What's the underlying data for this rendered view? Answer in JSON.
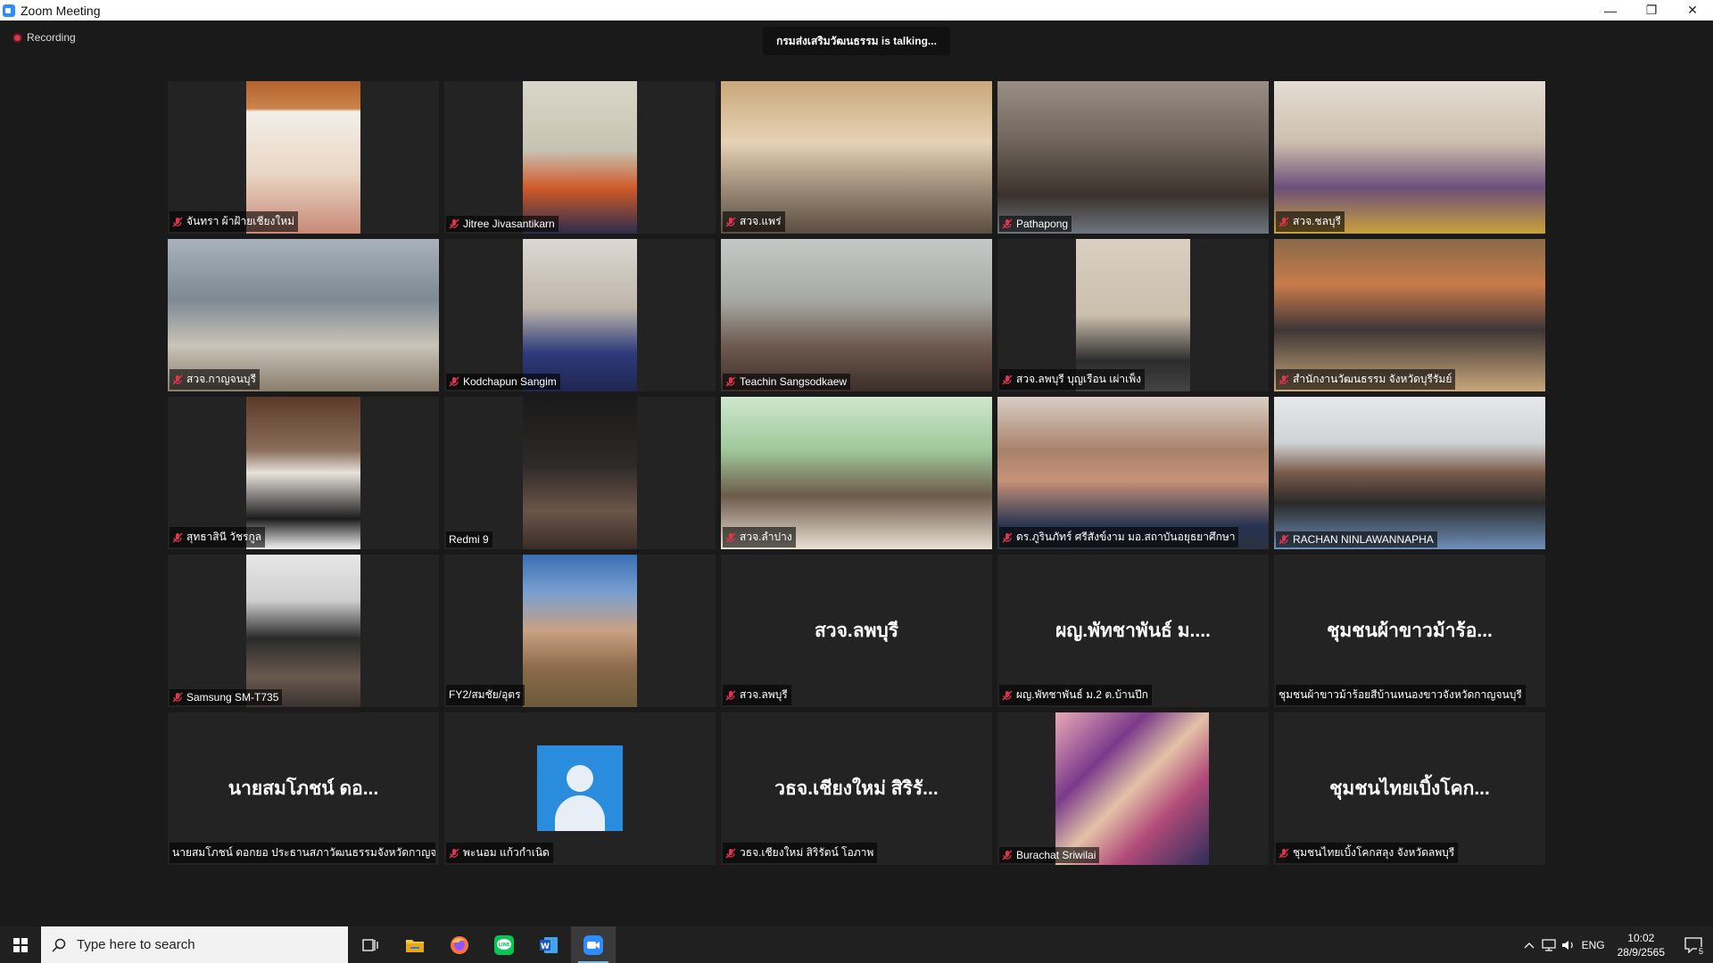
{
  "window": {
    "title": "Zoom Meeting",
    "minimize": "—",
    "maximize": "❐",
    "close": "✕"
  },
  "recording_label": "Recording",
  "talking_banner": "กรมส่งเสริมวัฒนธรรม is  talking...",
  "tiles": [
    {
      "name": "จันทรา  ผ้าฝ้ายเชียงใหม่",
      "muted": true
    },
    {
      "name": "Jitree Jivasantikarn",
      "muted": true
    },
    {
      "name": "สวจ.แพร่",
      "muted": true
    },
    {
      "name": "Pathapong",
      "muted": true
    },
    {
      "name": "สวจ.ชลบุรี",
      "muted": true
    },
    {
      "name": "สวจ.กาญจนบุรี",
      "muted": true
    },
    {
      "name": "Kodchapun Sangim",
      "muted": true
    },
    {
      "name": "Teachin Sangsodkaew",
      "muted": true
    },
    {
      "name": "สวจ.ลพบุรี บุญเรือน เผ่าเพ็ง",
      "muted": true
    },
    {
      "name": "สำนักงานวัฒนธรรม จังหวัดบุรีรัมย์",
      "muted": true
    },
    {
      "name": "สุทธาสินี วัชรกูล",
      "muted": true
    },
    {
      "name": "Redmi 9",
      "muted": false
    },
    {
      "name": "สวจ.ลำปาง",
      "muted": true
    },
    {
      "name": "ดร.ภูรินภัทร์ ศรีสังข์งาม มอ.สถาบันอยุธยาศึกษา",
      "muted": true
    },
    {
      "name": "RACHAN NINLAWANNAPHA",
      "muted": true
    },
    {
      "name": "Samsung SM-T735",
      "muted": true
    },
    {
      "name": "FY2/สมชัย/อุตร",
      "muted": false
    },
    {
      "name": "สวจ.ลพบุรี",
      "muted": true,
      "placeholder": "สวจ.ลพบุรี"
    },
    {
      "name": "ผญ.พัทชาพันธ์ ม.2 ต.บ้านปึก",
      "muted": true,
      "placeholder": "ผญ.พัทชาพันธ์ ม...."
    },
    {
      "name": "ชุมชนผ้าขาวม้าร้อยสีบ้านหนองขาวจังหวัดกาญจนบุรี",
      "muted": false,
      "placeholder": "ชุมชนผ้าขาวม้าร้อ..."
    },
    {
      "name": "นายสมโภชน์  ดอกยอ ประธานสภาวัฒนธรรมจังหวัดกาญจ...",
      "muted": false,
      "placeholder": "นายสมโภชน์  ดอ..."
    },
    {
      "name": "พะนอม แก้วกำเนิด",
      "muted": true
    },
    {
      "name": "วธจ.เชียงใหม่ สิริรัตน์ โอภาพ",
      "muted": true,
      "placeholder": "วธจ.เชียงใหม่ สิริรั..."
    },
    {
      "name": "Burachat Sriwilai",
      "muted": true
    },
    {
      "name": "ชุมชนไทยเบิ้งโคกสลุง จังหวัดลพบุรี",
      "muted": true,
      "placeholder": "ชุมชนไทยเบิ้งโคก..."
    }
  ],
  "taskbar": {
    "search_placeholder": "Type here to search",
    "apps": [
      "task-view",
      "file-explorer",
      "firefox",
      "line",
      "word",
      "zoom"
    ],
    "language": "ENG",
    "time": "10:02",
    "date": "28/9/2565",
    "notification_count": "5"
  },
  "colors": {
    "zoom_blue": "#2D8CFF",
    "muted_red": "#e0334d",
    "tile_bg": "#232323"
  }
}
